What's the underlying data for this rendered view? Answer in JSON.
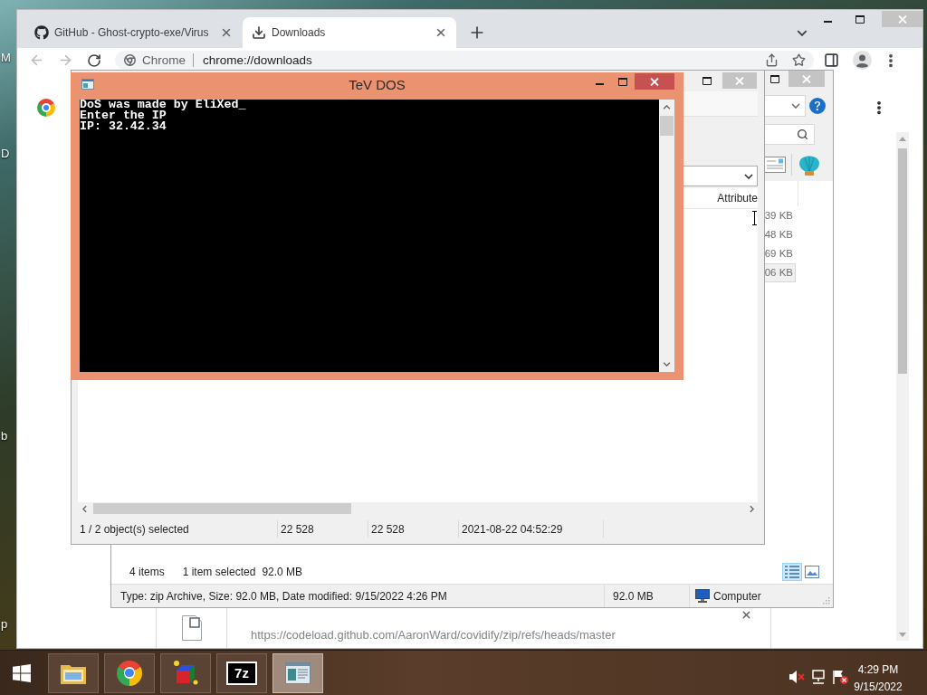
{
  "desktop": {
    "icon_labels": [
      "M",
      "D",
      "b",
      "p"
    ]
  },
  "browser": {
    "focused": false,
    "tabs": [
      {
        "kind": "github",
        "title": "GitHub - Ghost-crypto-exe/Virus",
        "selected": false
      },
      {
        "kind": "downloads",
        "title": "Downloads",
        "selected": true
      }
    ],
    "navigation": {
      "back_disabled": true,
      "forward_disabled": true
    },
    "omnibox": {
      "chip": "Chrome",
      "url": "chrome://downloads"
    },
    "downloads": [
      {
        "url": "https://codeload.github.com/AaronWard/covidify/zip/refs/heads/master"
      }
    ]
  },
  "file_explorer": {
    "focused": false,
    "size_column": [
      {
        "text": "39 KB",
        "selected": false
      },
      {
        "text": "48 KB",
        "selected": false
      },
      {
        "text": "69 KB",
        "selected": false
      },
      {
        "text": "06 KB",
        "selected": true
      }
    ],
    "item_count": "4 items",
    "selection": "1 item selected",
    "selection_size": "92.0 MB",
    "views": [
      {
        "kind": "details",
        "selected": true
      },
      {
        "kind": "large_icons",
        "selected": false
      }
    ],
    "status_bar": {
      "details": "Type: zip Archive, Size: 92.0 MB, Date modified: 9/15/2022 4:26 PM",
      "size": "92.0 MB",
      "location": "Computer"
    }
  },
  "archive_manager": {
    "focused": false,
    "columns": [
      "Attribute"
    ],
    "status_bar": [
      "1 / 2 object(s) selected",
      "22 528",
      "22 528",
      "2021-08-22 04:52:29"
    ]
  },
  "console": {
    "focused": true,
    "title": "TeV DOS",
    "lines": [
      "DoS was made by EliXed_",
      "Enter the IP",
      "IP: 32.42.34"
    ]
  },
  "taskbar": {
    "apps": [
      {
        "kind": "file_explorer",
        "active": false
      },
      {
        "kind": "chrome",
        "active": false
      },
      {
        "kind": "cube",
        "active": false
      },
      {
        "kind": "archiver",
        "logo": "7z",
        "active": false
      },
      {
        "kind": "window",
        "active": true
      }
    ],
    "tray": [
      {
        "kind": "volume_muted"
      },
      {
        "kind": "network"
      },
      {
        "kind": "flag_alert"
      }
    ],
    "clock": {
      "time": "4:29 PM",
      "date": "9/15/2022"
    }
  }
}
